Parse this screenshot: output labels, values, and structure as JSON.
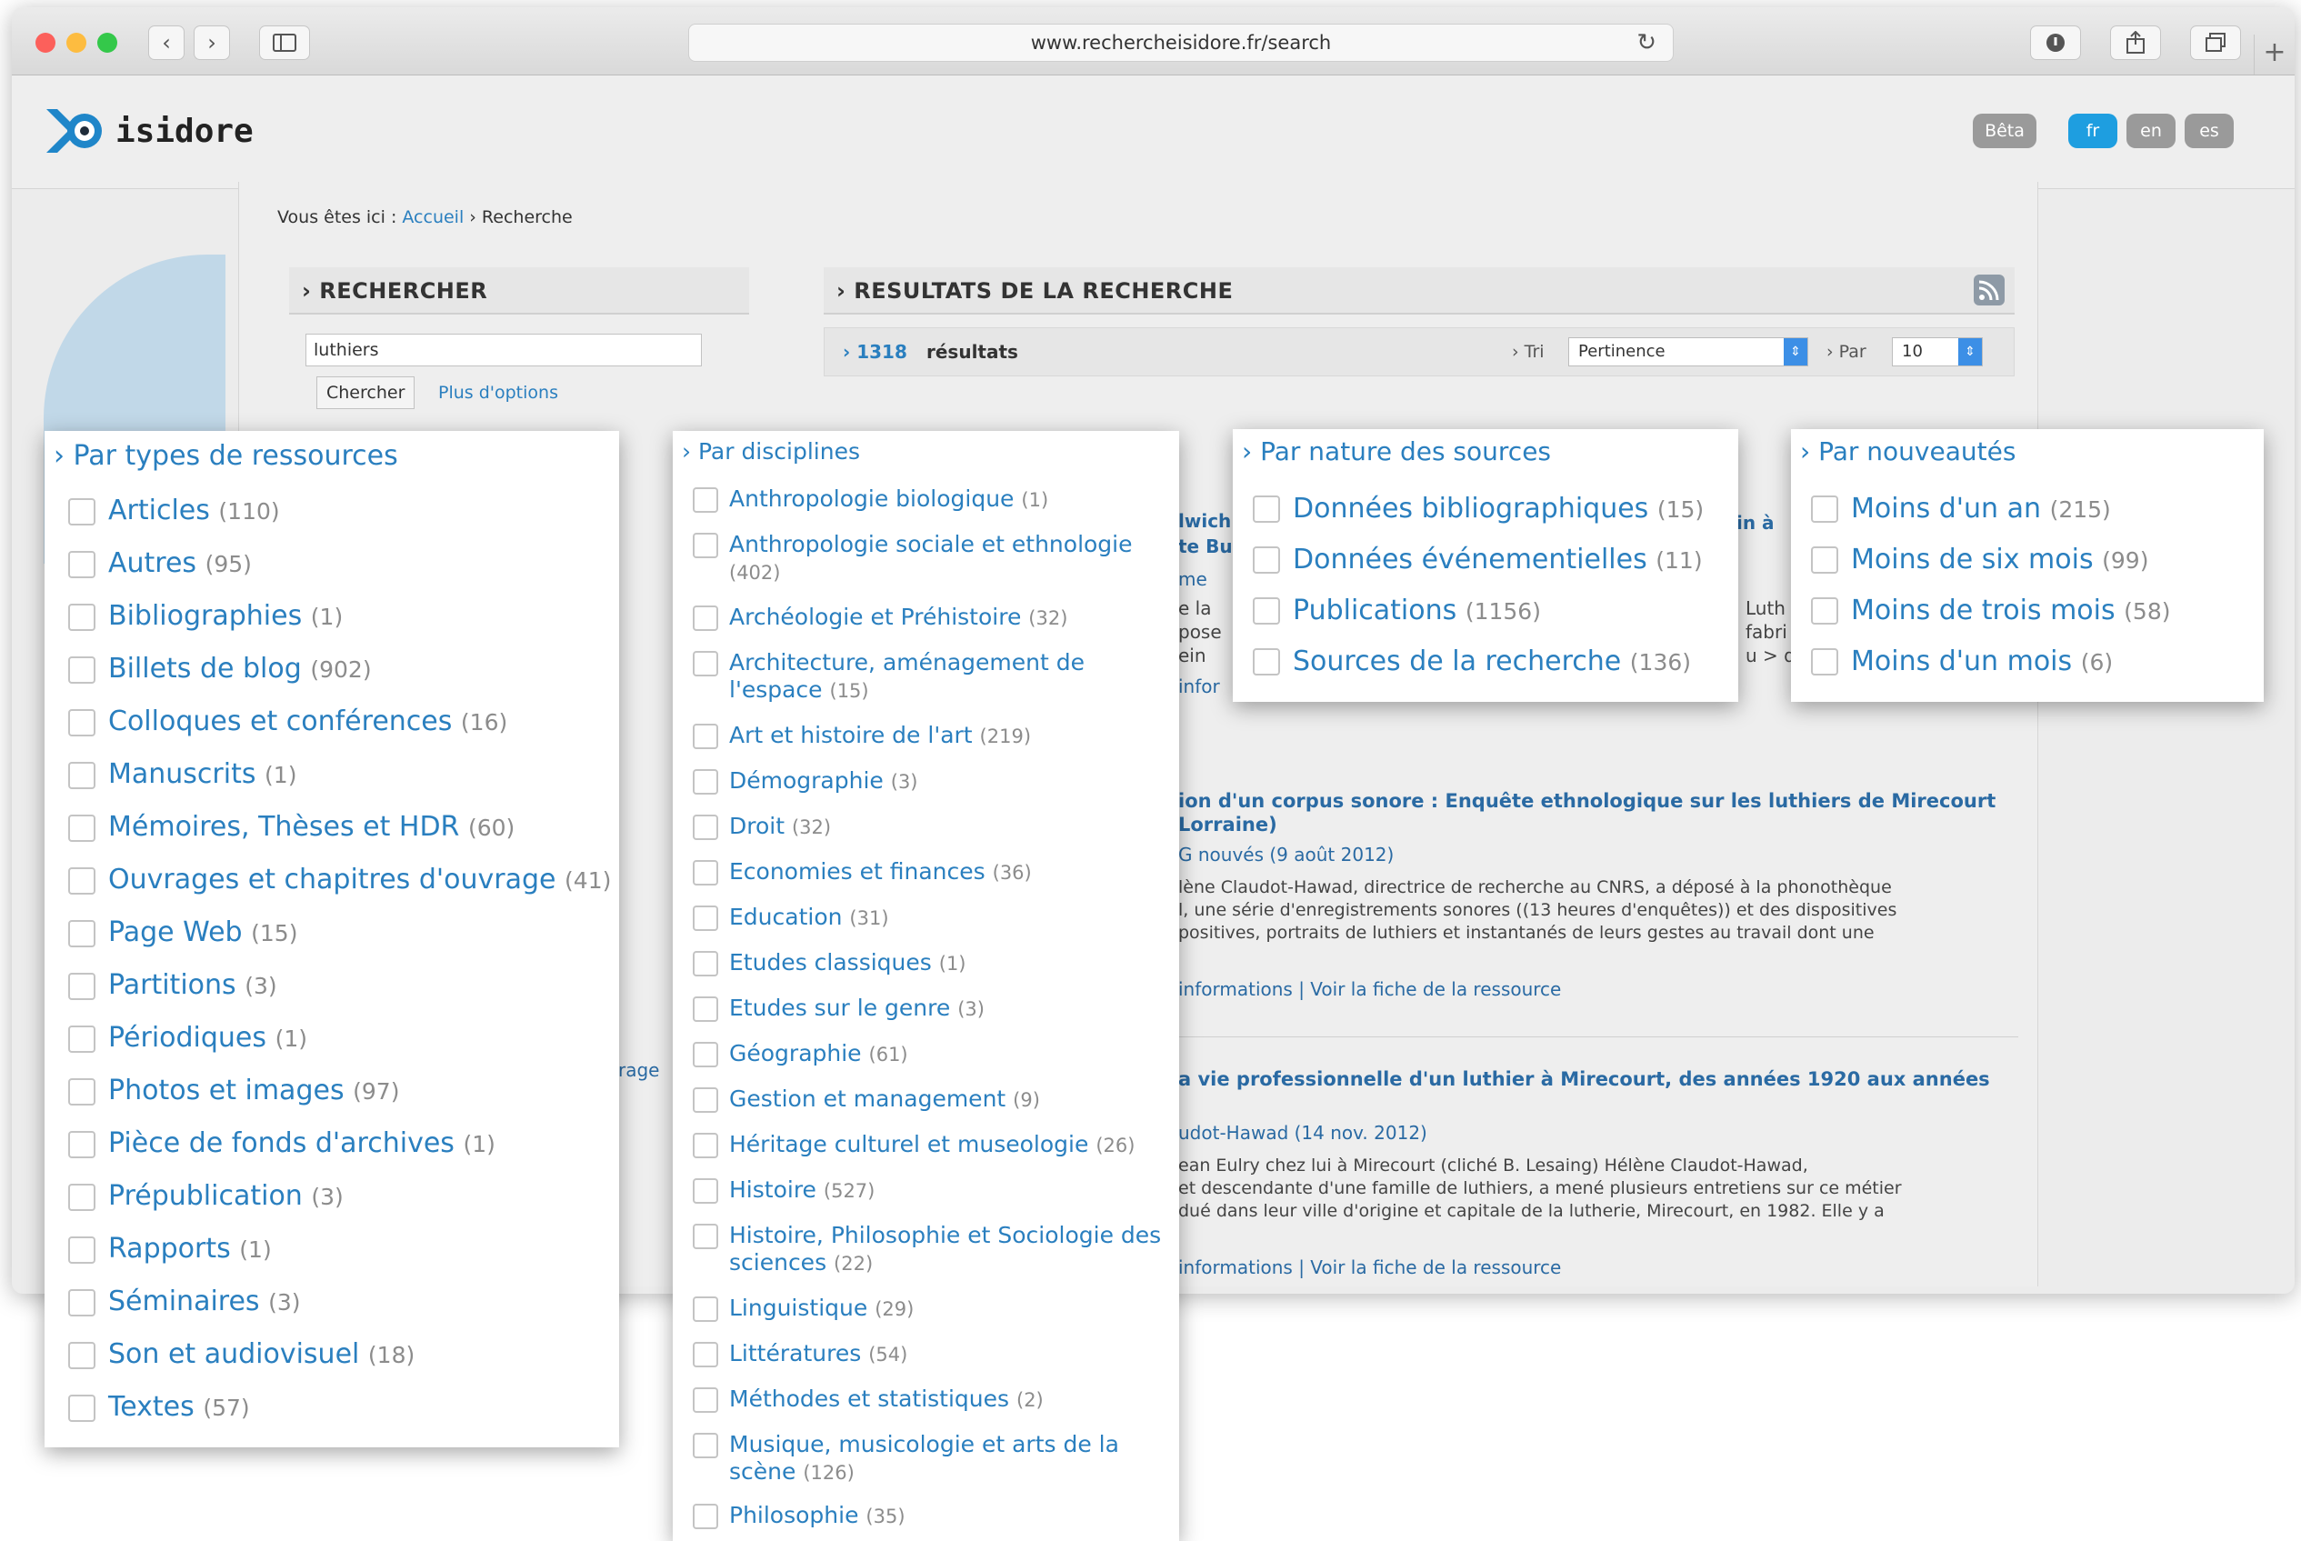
{
  "browser": {
    "url": "www.rechercheisidore.fr/search"
  },
  "site": {
    "logo_text": "isidore",
    "beta_label": "Bêta",
    "languages": [
      "fr",
      "en",
      "es"
    ],
    "accent": "#2a7fbf"
  },
  "breadcrumb": {
    "prefix": "Vous êtes ici :",
    "home": "Accueil",
    "current": "› Recherche"
  },
  "search": {
    "heading": "› RECHERCHER",
    "query": "luthiers",
    "submit_label": "Chercher",
    "more_options": "Plus d'options"
  },
  "results": {
    "heading": "› RESULTATS DE LA RECHERCHE",
    "count": "1318",
    "count_label": "résultats",
    "sort_label": "› Tri",
    "sort_value": "Pertinence",
    "per_page_label": "› Par",
    "per_page_value": "10",
    "items": [
      {
        "title": "ion d'un corpus sonore : Enquête ethnologique sur les luthiers de Mirecourt",
        "title_line2": "Lorraine)",
        "meta": "G nouvés (9 août 2012)",
        "text_lines": [
          "lène Claudot-Hawad, directrice de recherche au CNRS, a déposé à la phonothèque",
          "l, une série d'enregistrements sonores ((13 heures d'enquêtes)) et des dispositives",
          "positives, portraits de luthiers et instantanés de leurs gestes au travail dont une"
        ],
        "links": "informations | Voir la fiche de la ressource"
      },
      {
        "title": "a vie professionnelle d'un luthier à Mirecourt, des années 1920 aux années",
        "meta": "udot-Hawad (14 nov. 2012)",
        "text_lines": [
          "ean Eulry chez lui à Mirecourt (cliché B. Lesaing) Hélène Claudot-Hawad,",
          "et descendante d'une famille de luthiers, a mené plusieurs entretiens sur ce métier",
          "dué dans leur ville d'origine et capitale de la lutherie, Mirecourt, en 1982. Elle y a"
        ],
        "links": "informations | Voir la fiche de la ressource"
      }
    ],
    "fragments": {
      "a": "lwich",
      "b": "te Bu",
      "c": "me",
      "d": "e la",
      "e": "pose",
      "f": "ein",
      "g": "infor",
      "h": "in à",
      "i": "Luth",
      "j": "fabri",
      "k": "u > d",
      "l": "rage"
    }
  },
  "filters": {
    "types": {
      "title": "› Par types de ressources",
      "items": [
        {
          "label": "Articles",
          "count": "(110)"
        },
        {
          "label": "Autres",
          "count": "(95)"
        },
        {
          "label": "Bibliographies",
          "count": "(1)"
        },
        {
          "label": "Billets de blog",
          "count": "(902)"
        },
        {
          "label": "Colloques et conférences",
          "count": "(16)"
        },
        {
          "label": "Manuscrits",
          "count": "(1)"
        },
        {
          "label": "Mémoires, Thèses et HDR",
          "count": "(60)"
        },
        {
          "label": "Ouvrages et chapitres d'ouvrage",
          "count": "(41)"
        },
        {
          "label": "Page Web",
          "count": "(15)"
        },
        {
          "label": "Partitions",
          "count": "(3)"
        },
        {
          "label": "Périodiques",
          "count": "(1)"
        },
        {
          "label": "Photos et images",
          "count": "(97)"
        },
        {
          "label": "Pièce de fonds d'archives",
          "count": "(1)"
        },
        {
          "label": "Prépublication",
          "count": "(3)"
        },
        {
          "label": "Rapports",
          "count": "(1)"
        },
        {
          "label": "Séminaires",
          "count": "(3)"
        },
        {
          "label": "Son et audiovisuel",
          "count": "(18)"
        },
        {
          "label": "Textes",
          "count": "(57)"
        }
      ]
    },
    "disciplines": {
      "title": "› Par disciplines",
      "items": [
        {
          "label": "Anthropologie biologique",
          "count": "(1)"
        },
        {
          "label": "Anthropologie sociale et ethnologie",
          "count": "(402)"
        },
        {
          "label": "Archéologie et Préhistoire",
          "count": "(32)"
        },
        {
          "label": "Architecture, aménagement de l'espace",
          "count": "(15)"
        },
        {
          "label": "Art et histoire de l'art",
          "count": "(219)"
        },
        {
          "label": "Démographie",
          "count": "(3)"
        },
        {
          "label": "Droit",
          "count": "(32)"
        },
        {
          "label": "Economies et finances",
          "count": "(36)"
        },
        {
          "label": "Education",
          "count": "(31)"
        },
        {
          "label": "Etudes classiques",
          "count": "(1)"
        },
        {
          "label": "Etudes sur le genre",
          "count": "(3)"
        },
        {
          "label": "Géographie",
          "count": "(61)"
        },
        {
          "label": "Gestion et management",
          "count": "(9)"
        },
        {
          "label": "Héritage culturel et museologie",
          "count": "(26)"
        },
        {
          "label": "Histoire",
          "count": "(527)"
        },
        {
          "label": "Histoire, Philosophie et Sociologie des sciences",
          "count": "(22)"
        },
        {
          "label": "Linguistique",
          "count": "(29)"
        },
        {
          "label": "Littératures",
          "count": "(54)"
        },
        {
          "label": "Méthodes et statistiques",
          "count": "(2)"
        },
        {
          "label": "Musique, musicologie et arts de la scène",
          "count": "(126)"
        },
        {
          "label": "Philosophie",
          "count": "(35)"
        }
      ]
    },
    "sources": {
      "title": "› Par nature des sources",
      "items": [
        {
          "label": "Données bibliographiques",
          "count": "(15)"
        },
        {
          "label": "Données événementielles",
          "count": "(11)"
        },
        {
          "label": "Publications",
          "count": "(1156)"
        },
        {
          "label": "Sources de la recherche",
          "count": "(136)"
        }
      ]
    },
    "recency": {
      "title": "› Par nouveautés",
      "items": [
        {
          "label": "Moins d'un an",
          "count": "(215)"
        },
        {
          "label": "Moins de six mois",
          "count": "(99)"
        },
        {
          "label": "Moins de trois mois",
          "count": "(58)"
        },
        {
          "label": "Moins d'un mois",
          "count": "(6)"
        }
      ]
    }
  }
}
